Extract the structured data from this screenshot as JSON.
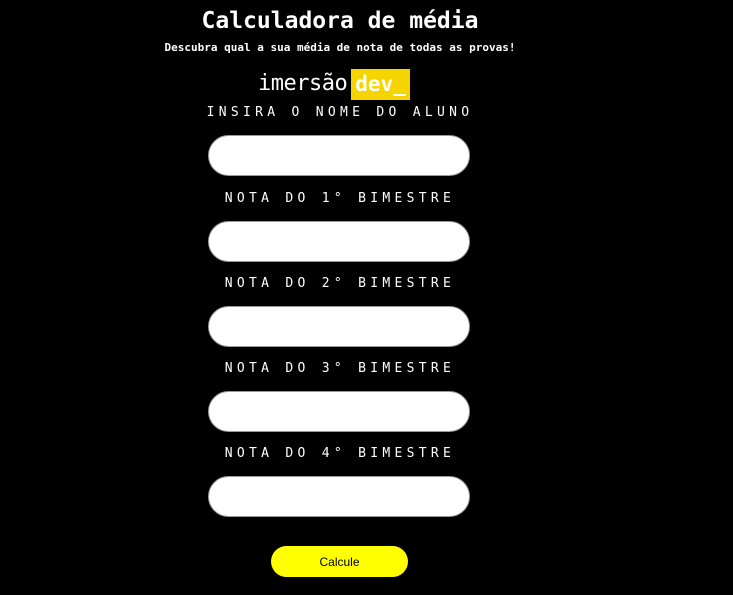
{
  "header": {
    "title": "Calculadora de média",
    "subtitle": "Descubra qual a sua média de nota de todas as provas!"
  },
  "logo": {
    "word": "imersão",
    "tag": "dev_"
  },
  "form": {
    "fields": [
      {
        "label": "INSIRA O NOME DO ALUNO",
        "value": "",
        "placeholder": ""
      },
      {
        "label": "NOTA DO 1° BIMESTRE",
        "value": "",
        "placeholder": ""
      },
      {
        "label": "NOTA DO 2° BIMESTRE",
        "value": "",
        "placeholder": ""
      },
      {
        "label": "NOTA DO 3° BIMESTRE",
        "value": "",
        "placeholder": ""
      },
      {
        "label": "NOTA DO 4° BIMESTRE",
        "value": "",
        "placeholder": ""
      }
    ],
    "submit_label": "Calcule"
  },
  "colors": {
    "background": "#000000",
    "text": "#ffffff",
    "accent": "#ffff00",
    "logo_tag": "#f5d400"
  }
}
